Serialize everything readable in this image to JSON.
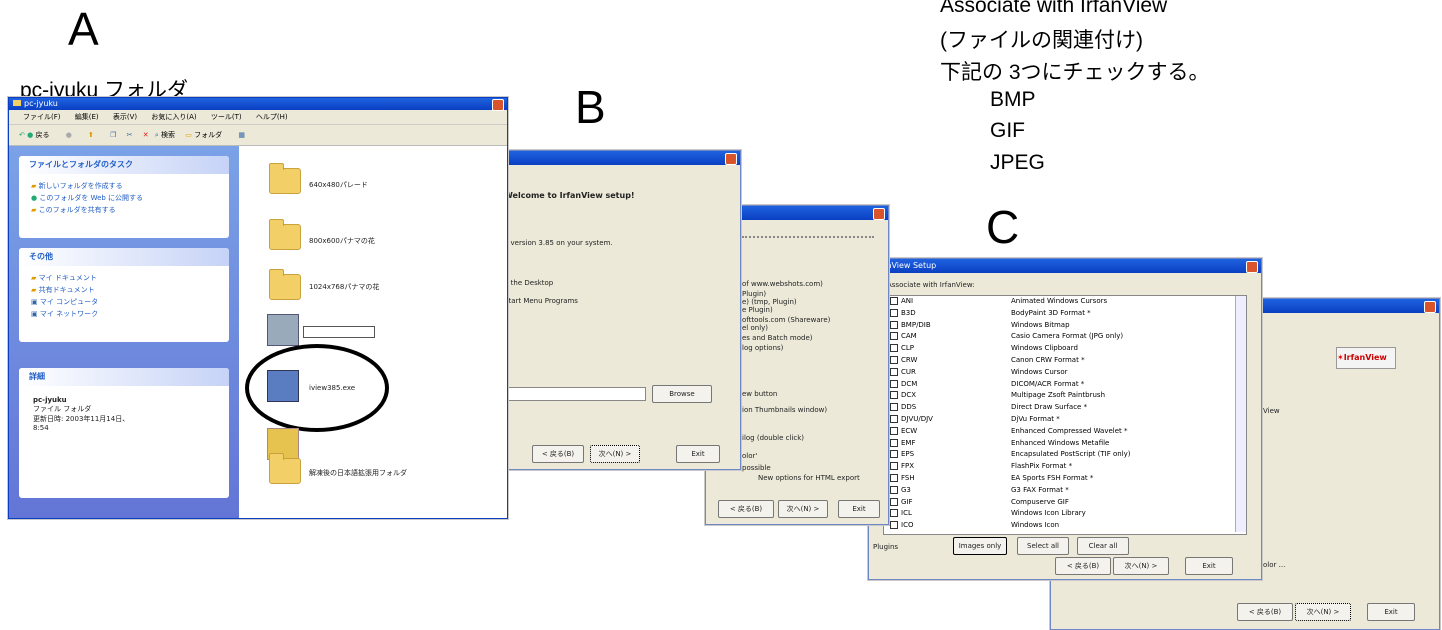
{
  "labels": {
    "a": "A",
    "a_caption": "pc-jyuku フォルダ",
    "b": "B",
    "c": "C",
    "note_line1": "Associate with IrfanView",
    "note_line2": "(ファイルの関連付け)",
    "note_line3": "下記の 3つにチェックする。",
    "formats": [
      "BMP",
      "GIF",
      "JPEG"
    ]
  },
  "explorer": {
    "title": "pc-jyuku",
    "menu": [
      "ファイル(F)",
      "編集(E)",
      "表示(V)",
      "お気に入り(A)",
      "ツール(T)",
      "ヘルプ(H)"
    ],
    "toolbar": {
      "back": "戻る",
      "search": "検索",
      "folders": "フォルダ"
    },
    "tasks": {
      "header": "ファイルとフォルダのタスク",
      "items": [
        "新しいフォルダを作成する",
        "このフォルダを Web に公開する",
        "このフォルダを共有する"
      ]
    },
    "other": {
      "header": "その他",
      "items": [
        "マイ ドキュメント",
        "共有ドキュメント",
        "マイ コンピュータ",
        "マイ ネットワーク"
      ]
    },
    "details": {
      "header": "詳細",
      "name": "pc-jyuku",
      "type": "ファイル フォルダ",
      "modified": "更新日時: 2003年11月14日、",
      "time": "8:54"
    },
    "files": [
      "640x480パレード",
      "800x600パナマの花",
      "1024x768パナマの花",
      "",
      "iview385.exe",
      "",
      "解凍後の日本語拡張用フォルダ"
    ]
  },
  "setup1": {
    "heading": "Welcome to IrfanView setup!",
    "version": "e version 3.85 on your system.",
    "opt1": "n the Desktop",
    "opt2": "Start Menu Programs",
    "browse": "Browse",
    "back": "< 戻る(B)",
    "next": "次へ(N) >",
    "exit": "Exit"
  },
  "setup2": {
    "lines": [
      "of www.webshots.com)",
      "Plugin)",
      "e) (tmp, Plugin)",
      "e Plugin)",
      "ofttools.com (Shareware)",
      "el only)",
      "es and Batch mode)",
      "log options)",
      "ew button",
      "ion Thumbnails window)",
      "ilog (double click)",
      "olor'",
      "possible"
    ],
    "html": "New options for HTML export",
    "back": "< 戻る(B)",
    "next": "次へ(N) >",
    "exit": "Exit"
  },
  "assoc": {
    "title": "IrfanView Setup",
    "heading": "Associate with IrfanView:",
    "exts": [
      "ANI",
      "B3D",
      "BMP/DIB",
      "CAM",
      "CLP",
      "CRW",
      "CUR",
      "DCM",
      "DCX",
      "DDS",
      "DJVU/DJV",
      "ECW",
      "EMF",
      "EPS",
      "FPX",
      "FSH",
      "G3",
      "GIF",
      "ICL",
      "ICO"
    ],
    "descs": [
      "Animated Windows Cursors",
      "BodyPaint 3D Format *",
      "Windows Bitmap",
      "Casio Camera Format (JPG only)",
      "Windows Clipboard",
      "Canon CRW Format *",
      "Windows Cursor",
      "DICOM/ACR Format *",
      "Multipage Zsoft Paintbrush",
      "Direct Draw Surface *",
      "DjVu Format *",
      "Enhanced Compressed Wavelet *",
      "Enhanced Windows Metafile",
      "Encapsulated PostScript (TIF only)",
      "FlashPix Format *",
      "EA Sports FSH Format *",
      "G3 FAX Format *",
      "Compuserve GIF",
      "Windows Icon Library",
      "Windows Icon"
    ],
    "plugins": "Plugins",
    "images_only": "Images only",
    "select_all": "Select all",
    "clear_all": "Clear all",
    "back": "< 戻る(B)",
    "next": "次へ(N) >",
    "exit": "Exit"
  },
  "final": {
    "logo": "IrfanView",
    "text1": "View",
    "text2": "olor ...",
    "back": "< 戻る(B)",
    "next": "次へ(N) >",
    "exit": "Exit"
  }
}
